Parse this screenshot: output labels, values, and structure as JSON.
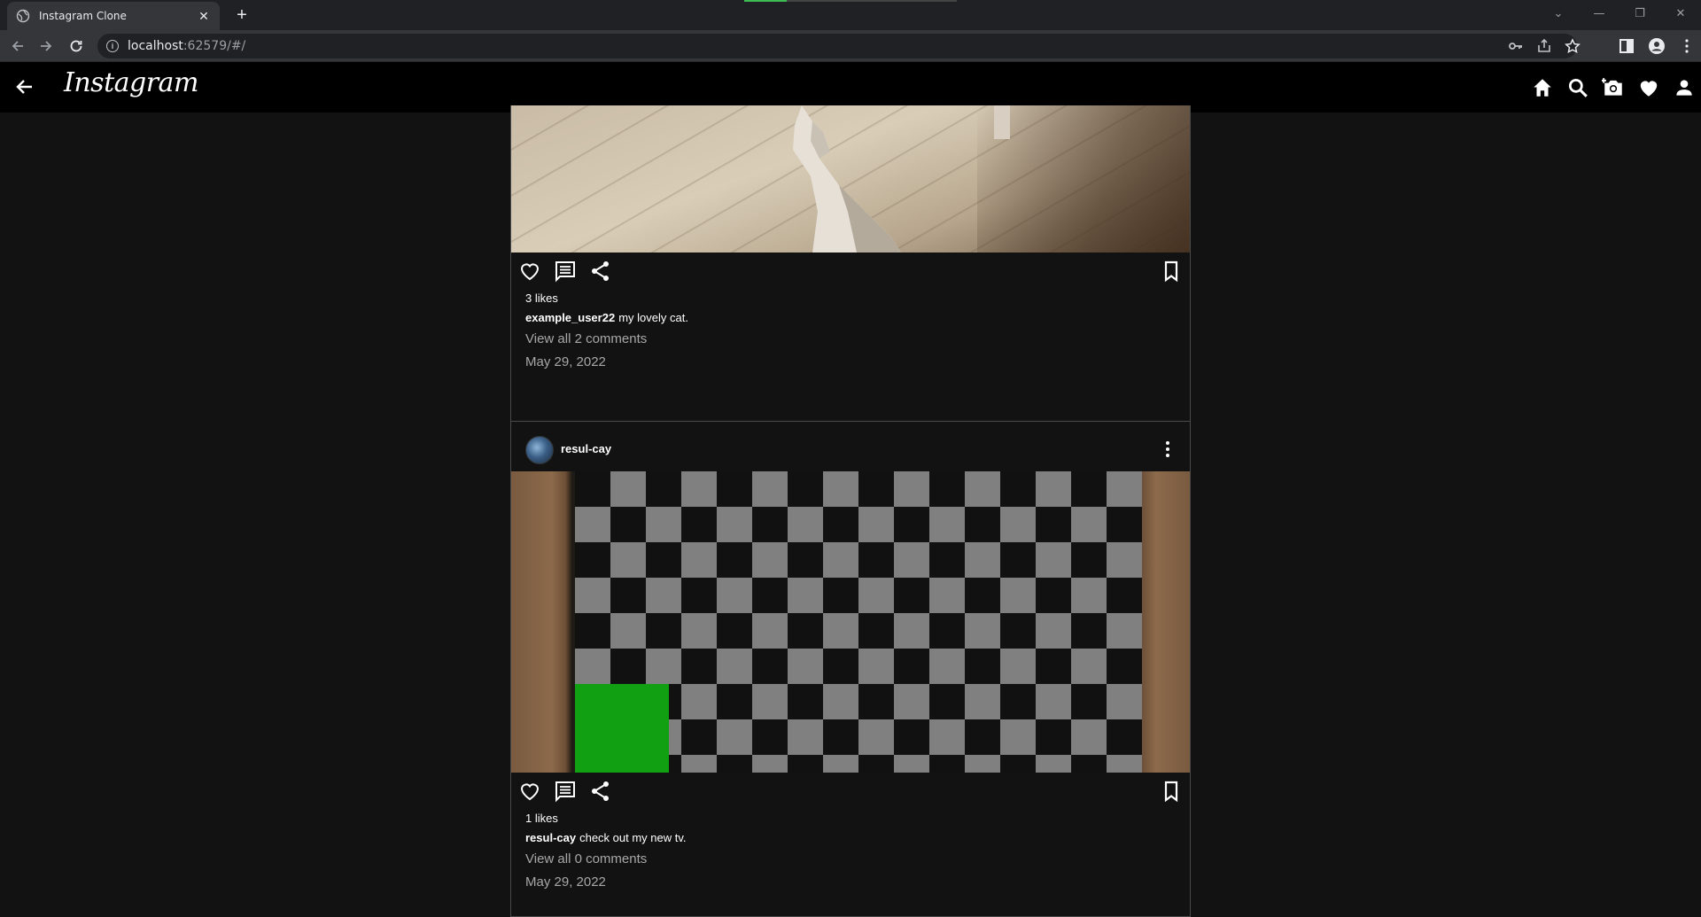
{
  "browser": {
    "tab_title": "Instagram Clone",
    "tab_close": "✕",
    "new_tab": "+",
    "url_host": "localhost",
    "url_path": ":62579/#/",
    "window_buttons": [
      "⌄",
      "—",
      "❐",
      "✕"
    ]
  },
  "app": {
    "logo": "Instagram"
  },
  "posts": [
    {
      "likes": "3 likes",
      "username": "example_user22",
      "caption": "my lovely cat.",
      "view_comments": "View all 2 comments",
      "date": "May 29, 2022"
    },
    {
      "username": "resul-cay",
      "likes": "1 likes",
      "caption": "check out my new tv.",
      "view_comments": "View all 0 comments",
      "date": "May 29, 2022"
    }
  ],
  "icons": {
    "back": "arrow-left-icon",
    "home": "home-icon",
    "search": "search-icon",
    "camera": "add-photo-icon",
    "heart": "heart-icon",
    "profile": "person-icon",
    "like": "heart-outline-icon",
    "comment": "comment-icon",
    "share": "share-icon",
    "bookmark": "bookmark-icon",
    "more": "more-vertical-icon"
  }
}
